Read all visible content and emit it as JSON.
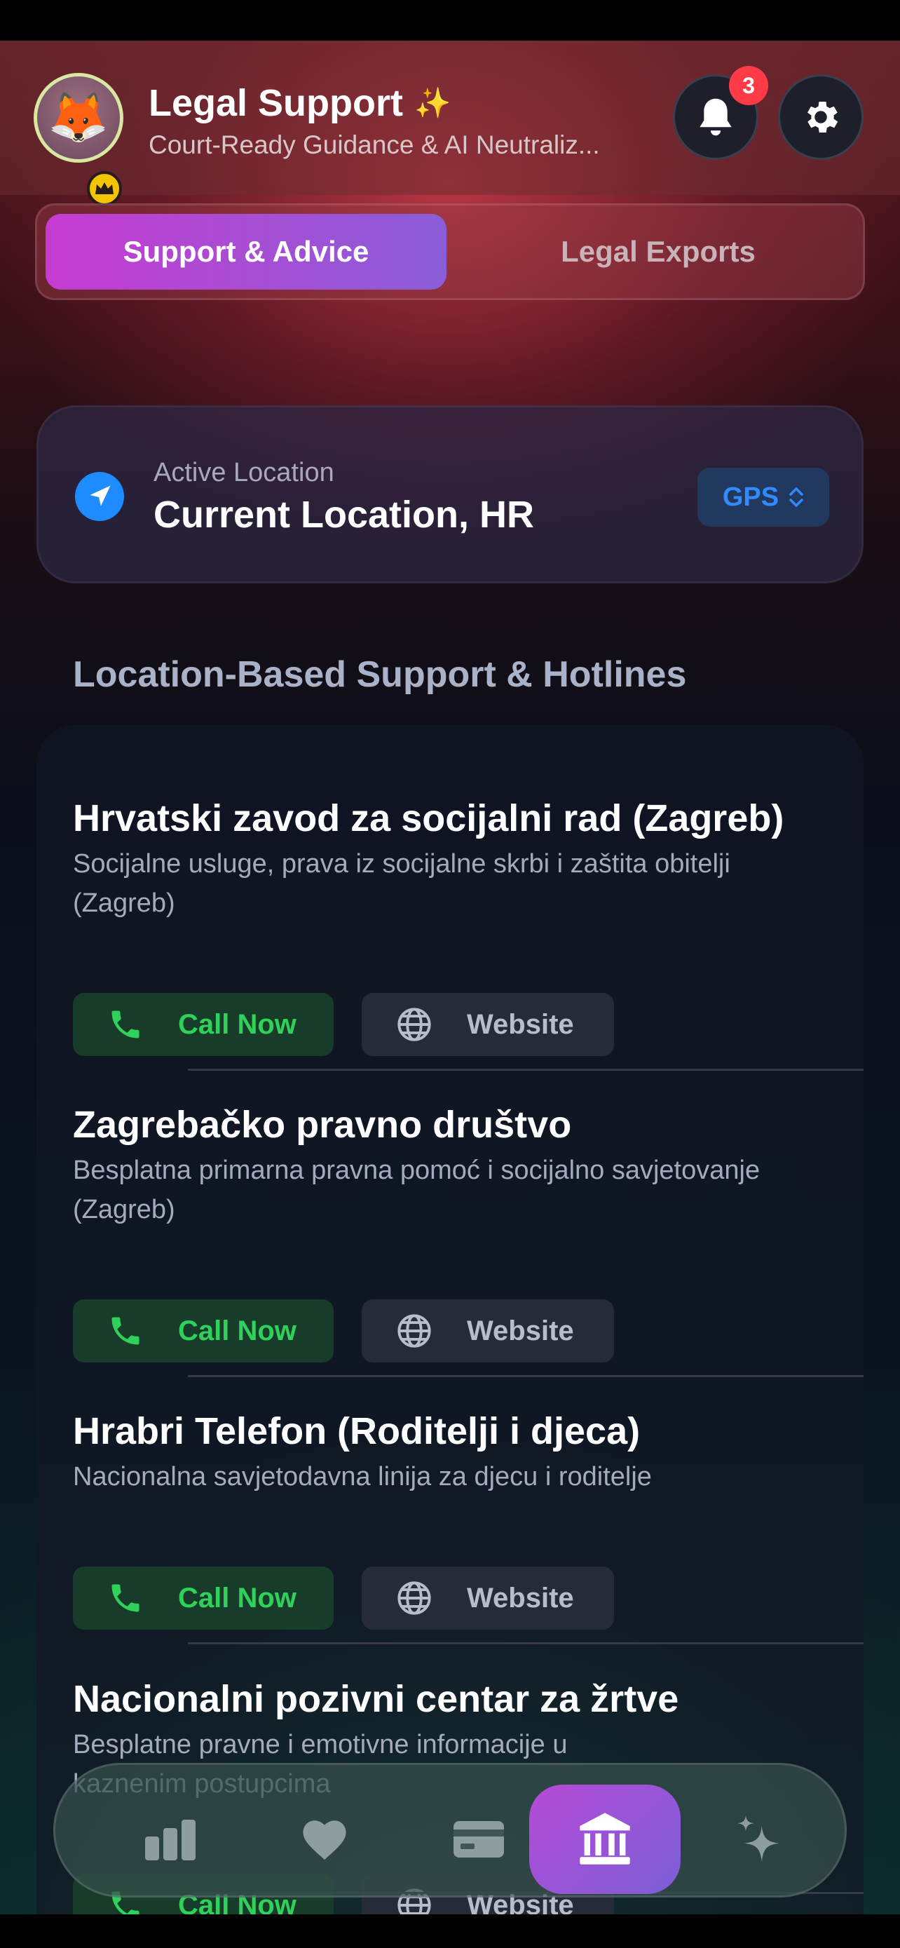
{
  "header": {
    "title": "Legal Support",
    "subtitle": "Court-Ready Guidance & AI Neutraliz...",
    "notification_count": "3",
    "avatar_emoji": "🦊"
  },
  "tabs": [
    {
      "label": "Support & Advice",
      "active": true
    },
    {
      "label": "Legal Exports",
      "active": false
    }
  ],
  "location": {
    "label": "Active Location",
    "value": "Current Location, HR",
    "mode_label": "GPS"
  },
  "section_title": "Location-Based Support & Hotlines",
  "entries": [
    {
      "title": "Hrvatski zavod za socijalni rad (Zagreb)",
      "description": "Socijalne usluge, prava iz socijalne skrbi i zaštita obitelji (Zagreb)",
      "call_label": "Call Now",
      "website_label": "Website"
    },
    {
      "title": "Zagrebačko pravno društvo",
      "description": "Besplatna primarna pravna pomoć i socijalno savjetovanje (Zagreb)",
      "call_label": "Call Now",
      "website_label": "Website"
    },
    {
      "title": "Hrabri Telefon (Roditelji i djeca)",
      "description": "Nacionalna savjetodavna linija za djecu i roditelje",
      "call_label": "Call Now",
      "website_label": "Website"
    },
    {
      "title": "Nacionalni pozivni centar za žrtve",
      "description": "Besplatne pravne i emotivne informacije u kaznenim postupcima",
      "call_label": "Call Now",
      "website_label": "Website"
    }
  ],
  "bottom_nav": [
    {
      "icon": "bar-chart-icon",
      "active": false
    },
    {
      "icon": "heart-icon",
      "active": false
    },
    {
      "icon": "card-icon",
      "active": false
    },
    {
      "icon": "courthouse-icon",
      "active": true
    },
    {
      "icon": "sparkles-icon",
      "active": false
    }
  ],
  "colors": {
    "accent_purple": "#c63bd1",
    "call_green": "#2fd15a",
    "gps_blue": "#2f8bff",
    "badge_red": "#ff3b47"
  }
}
